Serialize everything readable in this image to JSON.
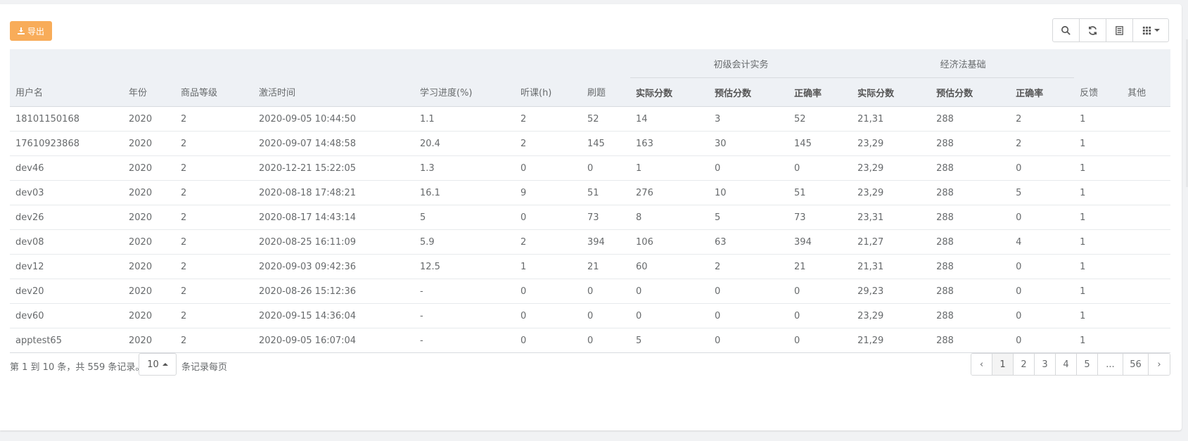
{
  "toolbar": {
    "export_label": "导出",
    "buttons": [
      "search-icon",
      "refresh-icon",
      "toggle-view-icon",
      "columns-icon"
    ]
  },
  "table": {
    "groups": {
      "g1": "初级会计实务",
      "g2": "经济法基础"
    },
    "headers": {
      "username": "用户名",
      "year": "年份",
      "level": "商品等级",
      "activated": "激活时间",
      "progress": "学习进度(%)",
      "listen": "听课(h)",
      "practice": "刷题",
      "g1_actual": "实际分数",
      "g1_estimate": "预估分数",
      "g1_accuracy": "正确率",
      "g2_actual": "实际分数",
      "g2_estimate": "预估分数",
      "g2_accuracy": "正确率",
      "feedback": "反馈",
      "other": "其他"
    },
    "rows": [
      [
        "18101150168",
        "2020",
        "2",
        "2020-09-05 10:44:50",
        "1.1",
        "2",
        "52",
        "14",
        "3",
        "52",
        "21,31",
        "288",
        "2",
        "1",
        ""
      ],
      [
        "17610923868",
        "2020",
        "2",
        "2020-09-07 14:48:58",
        "20.4",
        "2",
        "145",
        "163",
        "30",
        "145",
        "23,29",
        "288",
        "2",
        "1",
        ""
      ],
      [
        "dev46",
        "2020",
        "2",
        "2020-12-21 15:22:05",
        "1.3",
        "0",
        "0",
        "1",
        "0",
        "0",
        "23,29",
        "288",
        "0",
        "1",
        ""
      ],
      [
        "dev03",
        "2020",
        "2",
        "2020-08-18 17:48:21",
        "16.1",
        "9",
        "51",
        "276",
        "10",
        "51",
        "23,29",
        "288",
        "5",
        "1",
        ""
      ],
      [
        "dev26",
        "2020",
        "2",
        "2020-08-17 14:43:14",
        "5",
        "0",
        "73",
        "8",
        "5",
        "73",
        "23,31",
        "288",
        "0",
        "1",
        ""
      ],
      [
        "dev08",
        "2020",
        "2",
        "2020-08-25 16:11:09",
        "5.9",
        "2",
        "394",
        "106",
        "63",
        "394",
        "21,27",
        "288",
        "4",
        "1",
        ""
      ],
      [
        "dev12",
        "2020",
        "2",
        "2020-09-03 09:42:36",
        "12.5",
        "1",
        "21",
        "60",
        "2",
        "21",
        "21,31",
        "288",
        "0",
        "1",
        ""
      ],
      [
        "dev20",
        "2020",
        "2",
        "2020-08-26 15:12:36",
        "-",
        "0",
        "0",
        "0",
        "0",
        "0",
        "29,23",
        "288",
        "0",
        "1",
        ""
      ],
      [
        "dev60",
        "2020",
        "2",
        "2020-09-15 14:36:04",
        "-",
        "0",
        "0",
        "0",
        "0",
        "0",
        "23,29",
        "288",
        "0",
        "1",
        ""
      ],
      [
        "apptest65",
        "2020",
        "2",
        "2020-09-05 16:07:04",
        "-",
        "0",
        "0",
        "5",
        "0",
        "0",
        "21,29",
        "288",
        "0",
        "1",
        ""
      ]
    ]
  },
  "footer": {
    "summary": "第 1 到 10 条，共 559 条记录。",
    "page_size": "10",
    "per_page_label": "条记录每页",
    "pages": [
      "‹",
      "1",
      "2",
      "3",
      "4",
      "5",
      "...",
      "56",
      "›"
    ],
    "active_page": "1"
  }
}
